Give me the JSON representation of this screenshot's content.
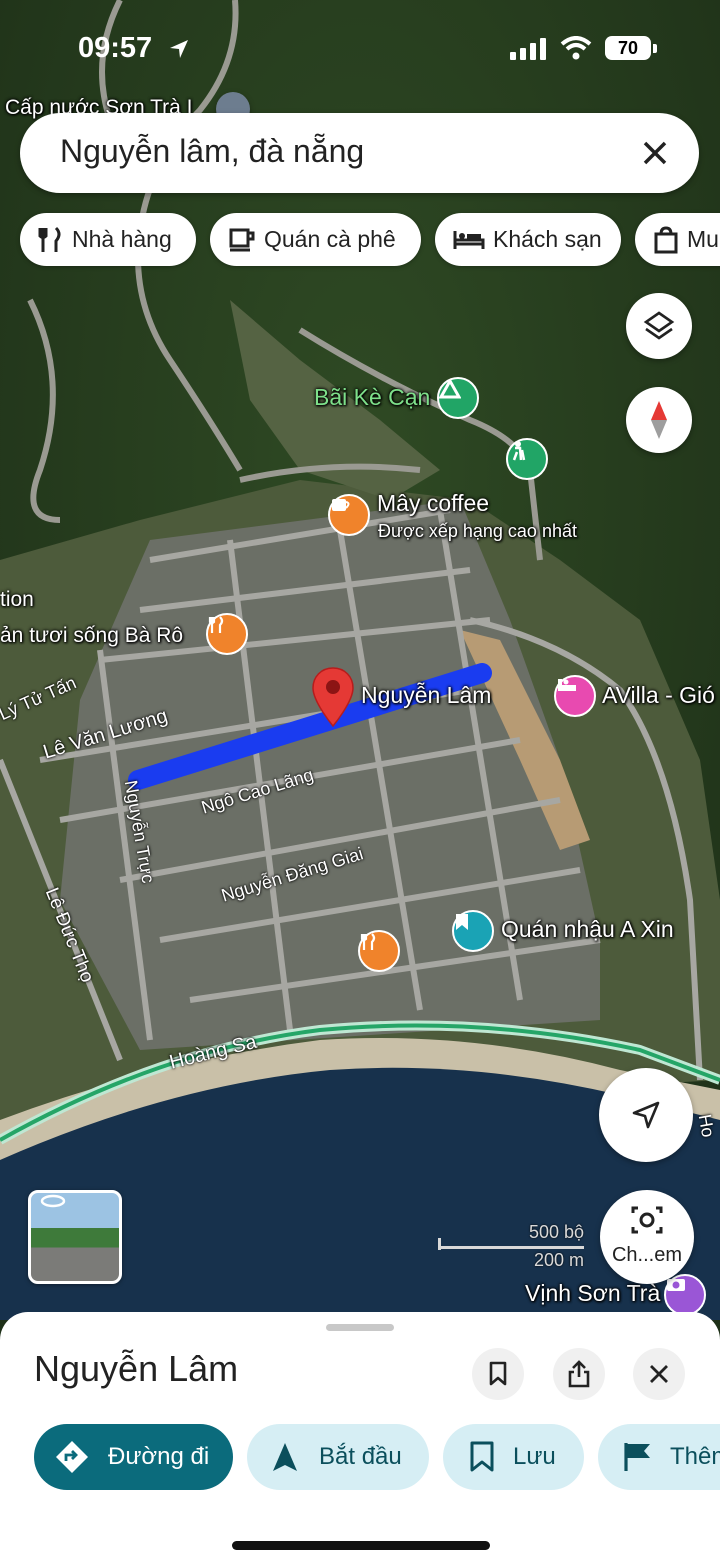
{
  "status_bar": {
    "time": "09:57",
    "battery": "70"
  },
  "search": {
    "query": "Nguyễn lâm, đà nẵng"
  },
  "chips": [
    {
      "label": "Nhà hàng",
      "icon": "fork-knife-icon"
    },
    {
      "label": "Quán cà phê",
      "icon": "coffee-cup-icon"
    },
    {
      "label": "Khách sạn",
      "icon": "bed-icon"
    },
    {
      "label": "Mu",
      "icon": "shopping-bag-icon"
    }
  ],
  "map": {
    "pois": {
      "cap_nuoc": "Cấp nước Sơn Trà I",
      "bai_ke_can": "Bãi Kè Cạn",
      "may_coffee": "Mây coffee",
      "may_coffee_sub": "Được xếp hạng cao nhất",
      "tion": "tion",
      "hai_san": "ản tươi sống Bà Rô",
      "selected": "Nguyễn Lâm",
      "avilla": "AVilla - Gió",
      "quan_nhau": "Quán nhậu A Xin",
      "vinh_son_tra": "Vịnh Sơn Trà"
    },
    "roads": {
      "ly_tu_tan": "Lý Tử Tấn",
      "le_van_luong": "Lê Văn Lương",
      "ngo_cao_lang": "Ngô Cao Lãng",
      "nguyen_truc": "Nguyễn Trực",
      "nguyen_dang_giai": "Nguyễn Đăng Giai",
      "le_duc_tho": "Lê Đức Thọ",
      "hoang_sa": "Hoàng Sa",
      "ho": "Ho"
    },
    "scale": {
      "top": "500 bộ",
      "bottom": "200 m"
    },
    "lens_label": "Ch...em"
  },
  "place": {
    "title": "Nguyễn Lâm",
    "actions": [
      {
        "label": "Đường đi",
        "icon": "directions-icon"
      },
      {
        "label": "Bắt đầu",
        "icon": "navigation-arrow-icon"
      },
      {
        "label": "Lưu",
        "icon": "bookmark-icon"
      },
      {
        "label": "Thêm",
        "icon": "flag-icon"
      }
    ]
  },
  "colors": {
    "primary": "#0b6b7c",
    "chip_light": "#d6eef4",
    "route": "#1a3cf0",
    "pin": "#e53935"
  }
}
